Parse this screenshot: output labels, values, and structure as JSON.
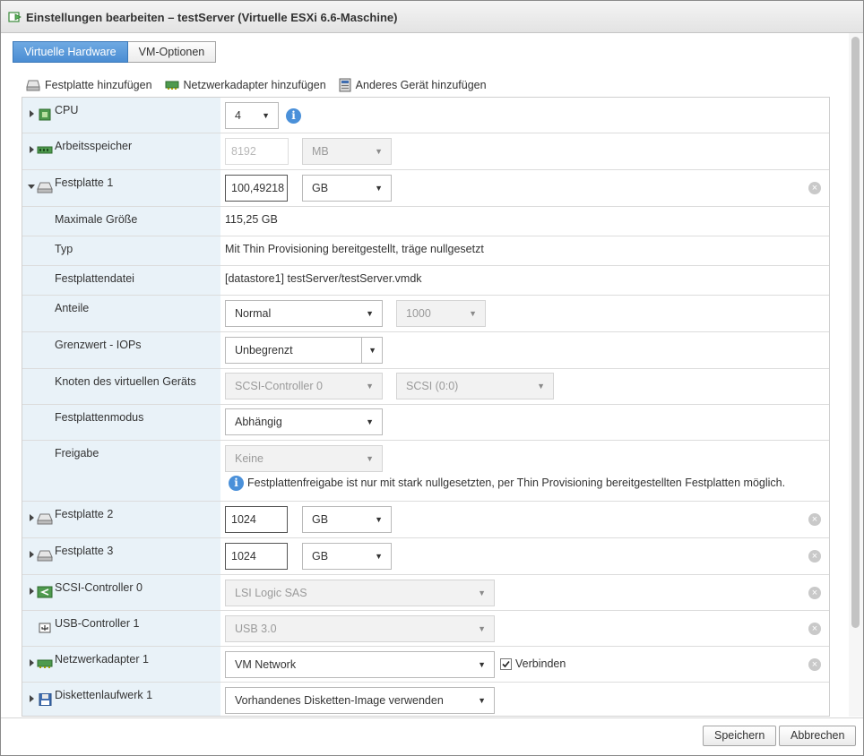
{
  "dialog": {
    "title": "Einstellungen bearbeiten – testServer (Virtuelle ESXi 6.6-Maschine)"
  },
  "tabs": [
    {
      "label": "Virtuelle Hardware",
      "active": true
    },
    {
      "label": "VM-Optionen",
      "active": false
    }
  ],
  "toolbar": {
    "add_disk": "Festplatte hinzufügen",
    "add_nic": "Netzwerkadapter hinzufügen",
    "add_other": "Anderes Gerät hinzufügen"
  },
  "rows": {
    "cpu": {
      "label": "CPU",
      "value": "4"
    },
    "memory": {
      "label": "Arbeitsspeicher",
      "value": "8192",
      "unit": "MB"
    },
    "disk1": {
      "label": "Festplatte 1",
      "value": "100,49218",
      "unit": "GB",
      "max_size_label": "Maximale Größe",
      "max_size": "115,25 GB",
      "type_label": "Typ",
      "type": "Mit Thin Provisioning bereitgestellt, träge nullgesetzt",
      "file_label": "Festplattendatei",
      "file": "[datastore1] testServer/testServer.vmdk",
      "shares_label": "Anteile",
      "shares": "Normal",
      "shares_value": "1000",
      "iops_label": "Grenzwert - IOPs",
      "iops": "Unbegrenzt",
      "node_label": "Knoten des virtuellen Geräts",
      "controller": "SCSI-Controller 0",
      "node": "SCSI (0:0)",
      "mode_label": "Festplattenmodus",
      "mode": "Abhängig",
      "sharing_label": "Freigabe",
      "sharing": "Keine",
      "sharing_note": "Festplattenfreigabe ist nur mit stark nullgesetzten, per Thin Provisioning bereitgestellten Festplatten möglich."
    },
    "disk2": {
      "label": "Festplatte 2",
      "value": "1024",
      "unit": "GB"
    },
    "disk3": {
      "label": "Festplatte 3",
      "value": "1024",
      "unit": "GB"
    },
    "scsi": {
      "label": "SCSI-Controller 0",
      "value": "LSI Logic SAS"
    },
    "usb": {
      "label": "USB-Controller 1",
      "value": "USB 3.0"
    },
    "nic": {
      "label": "Netzwerkadapter 1",
      "value": "VM Network",
      "connect_label": "Verbinden",
      "connected": true
    },
    "floppy": {
      "label": "Diskettenlaufwerk 1",
      "value": "Vorhandenes Disketten-Image verwenden"
    }
  },
  "footer": {
    "save": "Speichern",
    "cancel": "Abbrechen"
  },
  "icons": {
    "dropdown": "▼",
    "expanded_caret": "caret-down",
    "collapsed_caret": "caret-right",
    "remove": "×",
    "info": "i"
  },
  "colors": {
    "accent": "#4b8dd3",
    "label_column": "#e9f2f8",
    "info": "#4a90d9"
  }
}
